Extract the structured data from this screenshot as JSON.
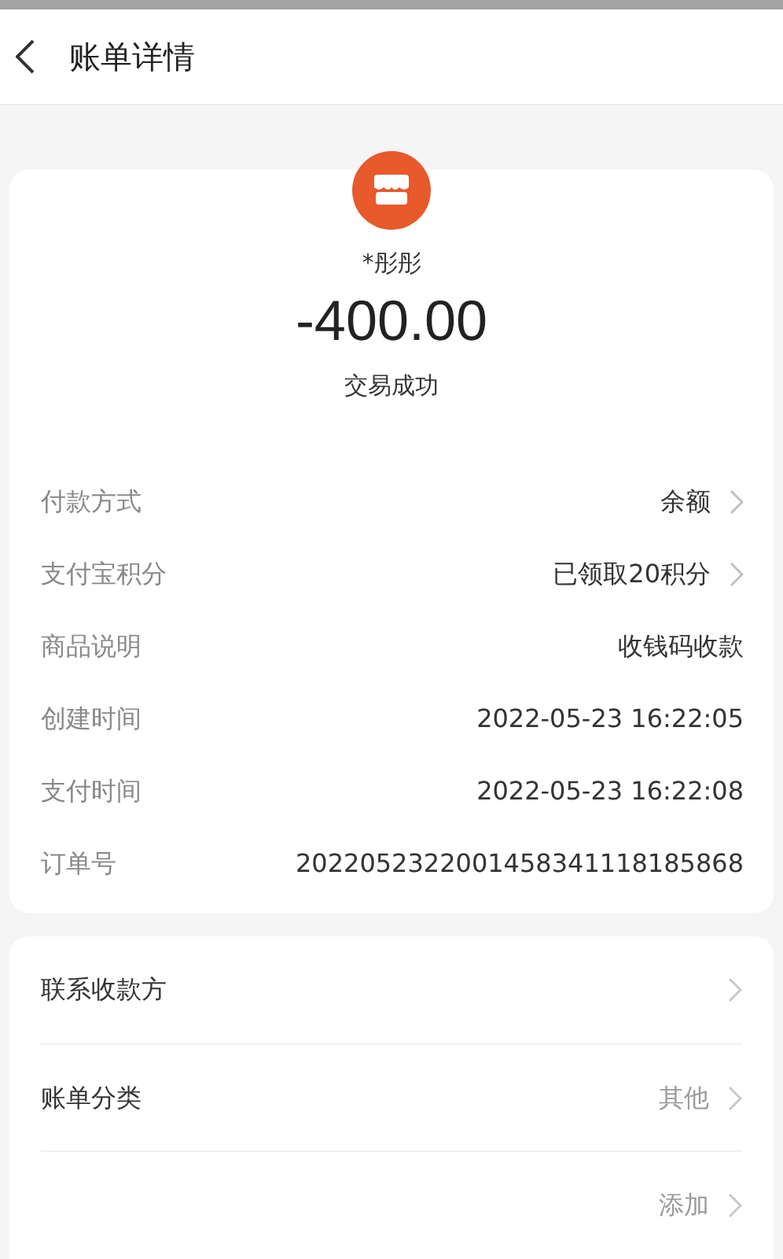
{
  "header": {
    "title": "账单详情"
  },
  "summary": {
    "payee": "*彤彤",
    "amount": "-400.00",
    "status": "交易成功"
  },
  "details": [
    {
      "label": "付款方式",
      "value": "余额",
      "has_arrow": true
    },
    {
      "label": "支付宝积分",
      "value": "已领取20积分",
      "has_arrow": true
    },
    {
      "label": "商品说明",
      "value": "收钱码收款",
      "has_arrow": false
    },
    {
      "label": "创建时间",
      "value": "2022-05-23 16:22:05",
      "has_arrow": false
    },
    {
      "label": "支付时间",
      "value": "2022-05-23 16:22:08",
      "has_arrow": false
    },
    {
      "label": "订单号",
      "value": "2022052322001458341118185868",
      "has_arrow": false
    }
  ],
  "actions": [
    {
      "label": "联系收款方"
    },
    {
      "label": "账单分类",
      "value": "其他"
    },
    {
      "value": "添加"
    }
  ]
}
